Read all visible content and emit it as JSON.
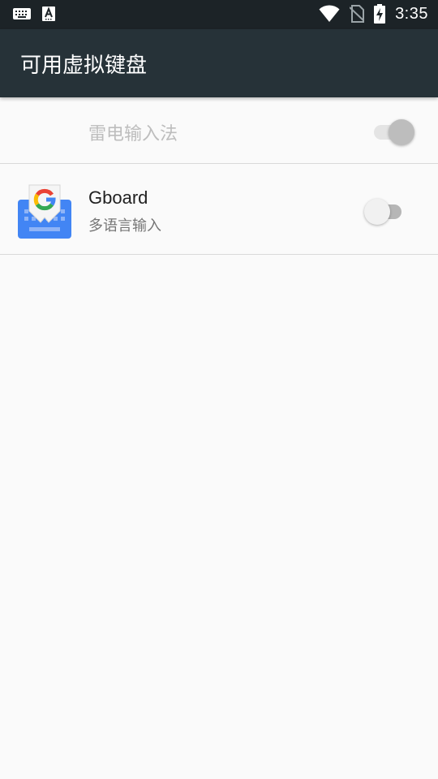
{
  "status_bar": {
    "time": "3:35",
    "left_icons": [
      "keyboard-icon",
      "text-a-icon"
    ],
    "right_icons": [
      "wifi-icon",
      "no-sim-icon",
      "battery-charging-icon"
    ]
  },
  "toolbar": {
    "title": "可用虚拟键盘"
  },
  "keyboards": [
    {
      "name": "雷电输入法",
      "enabled": true,
      "switch_disabled": true
    },
    {
      "name": "Gboard",
      "subtitle": "多语言输入",
      "enabled": false,
      "icon": "gboard-icon"
    }
  ],
  "colors": {
    "toolbar": "#263238",
    "status_bar": "#1c2327",
    "background": "#fafafa"
  }
}
